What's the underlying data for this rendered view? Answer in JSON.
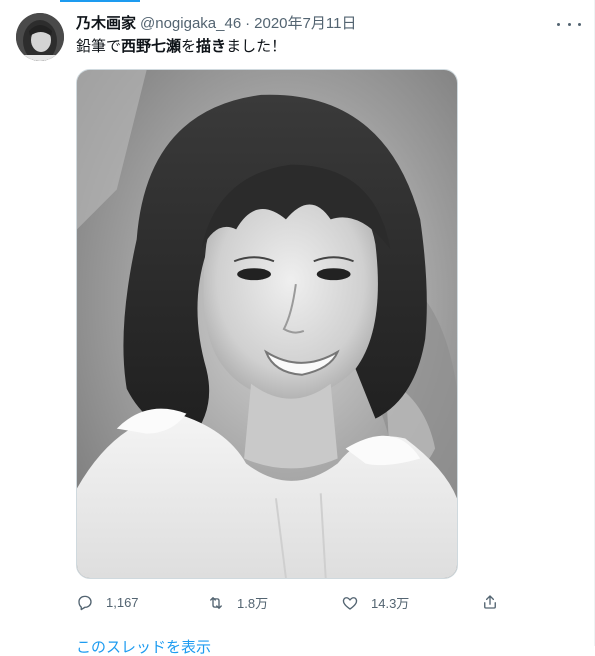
{
  "tweet": {
    "author_name": "乃木画家",
    "handle": "@nogigaka_46",
    "separator": "·",
    "date": "2020年7月11日",
    "text_prefix": "鉛筆で",
    "text_bold": "西野七瀬",
    "text_mid": "を",
    "text_bold2": "描き",
    "text_suffix": "ました！"
  },
  "actions": {
    "reply_count": "1,167",
    "retweet_count": "1.8万",
    "like_count": "14.3万"
  },
  "thread_link": "このスレッドを表示",
  "icons": {
    "more": "more-horizontal-icon",
    "reply": "reply-icon",
    "retweet": "retweet-icon",
    "like": "heart-icon",
    "share": "share-icon"
  },
  "colors": {
    "accent": "#1d9bf0",
    "muted": "#536471",
    "text": "#0f1419"
  }
}
